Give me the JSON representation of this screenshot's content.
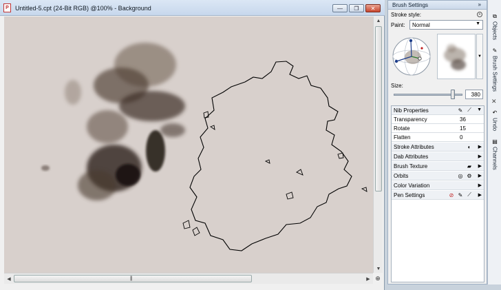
{
  "document": {
    "title": "Untitled-5.cpt (24-Bit RGB) @100% - Background",
    "icon": "corel-document-icon",
    "canvas_color": "#d8d0cc"
  },
  "window_controls": {
    "minimize": "—",
    "restore": "❐",
    "close": "✕"
  },
  "scrollbar": {
    "grip": "|||"
  },
  "docker": {
    "title": "Brush Settings",
    "chevron": "»",
    "stroke_style_label": "Stroke style:",
    "paint_label": "Paint:",
    "paint_value": "Normal",
    "size_label": "Size:",
    "size_value": "380",
    "size_level_fraction": 0.9
  },
  "properties": [
    {
      "label": "Nib Properties",
      "type": "section",
      "expanded": true
    },
    {
      "label": "Transparency",
      "value": "36"
    },
    {
      "label": "Rotate",
      "value": "15"
    },
    {
      "label": "Flatten",
      "value": "0"
    },
    {
      "label": "Stroke Attributes",
      "type": "section"
    },
    {
      "label": "Dab Attributes",
      "type": "section"
    },
    {
      "label": "Brush Texture",
      "type": "section"
    },
    {
      "label": "Orbits",
      "type": "section"
    },
    {
      "label": "Color Variation",
      "type": "section"
    },
    {
      "label": "Pen Settings",
      "type": "section"
    }
  ],
  "vertical_tabs": [
    {
      "label": "Objects",
      "icon": "objects-icon"
    },
    {
      "label": "Brush Settings",
      "icon": "brush-icon"
    },
    {
      "label": "Undo",
      "icon": "undo-icon"
    },
    {
      "label": "Channels",
      "icon": "channels-icon"
    }
  ],
  "colors": {
    "accent": "#c8462e",
    "panel": "#f0f0f0",
    "titlebar": "#c7d7ec"
  }
}
